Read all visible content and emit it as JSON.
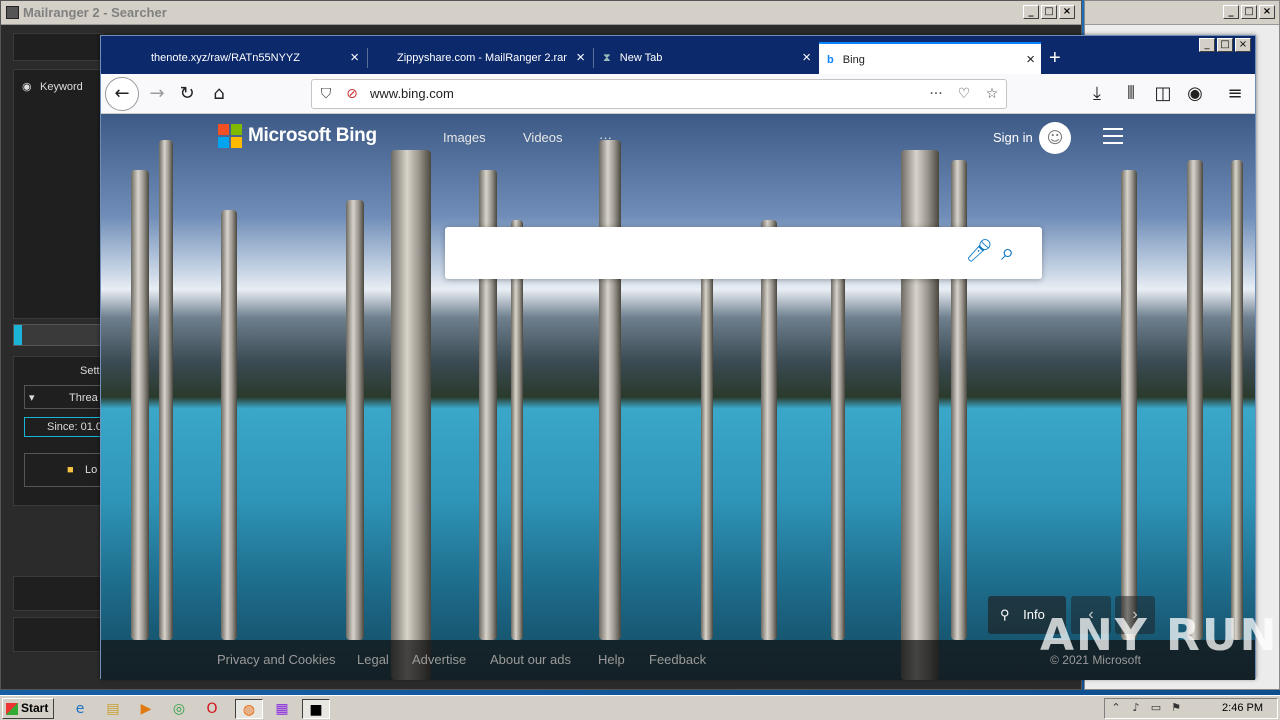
{
  "mailranger": {
    "title": "Mailranger 2 - Searcher",
    "keyword_label": "Keyword",
    "settings_label": "Sett",
    "threads_label": "Threa",
    "since_label": "Since: 01.0",
    "load_label": "Lo"
  },
  "desktop": {
    "icon_label": "player"
  },
  "firefox": {
    "tabs": [
      {
        "label": "thenote.xyz/raw/RATn55NYYZ"
      },
      {
        "label": "Zippyshare.com - MailRanger 2.rar"
      },
      {
        "label": "New Tab"
      },
      {
        "label": "Bing"
      }
    ],
    "url": "www.bing.com"
  },
  "bing": {
    "brand": "Microsoft Bing",
    "nav": [
      "Images",
      "Videos",
      "···"
    ],
    "signin": "Sign in",
    "info": "Info",
    "footer_links": [
      "Privacy and Cookies",
      "Legal",
      "Advertise",
      "About our ads",
      "Help",
      "Feedback"
    ],
    "copyright": "© 2021 Microsoft"
  },
  "watermark": "ANY RUN",
  "taskbar": {
    "start": "Start",
    "clock": "2:46 PM"
  }
}
